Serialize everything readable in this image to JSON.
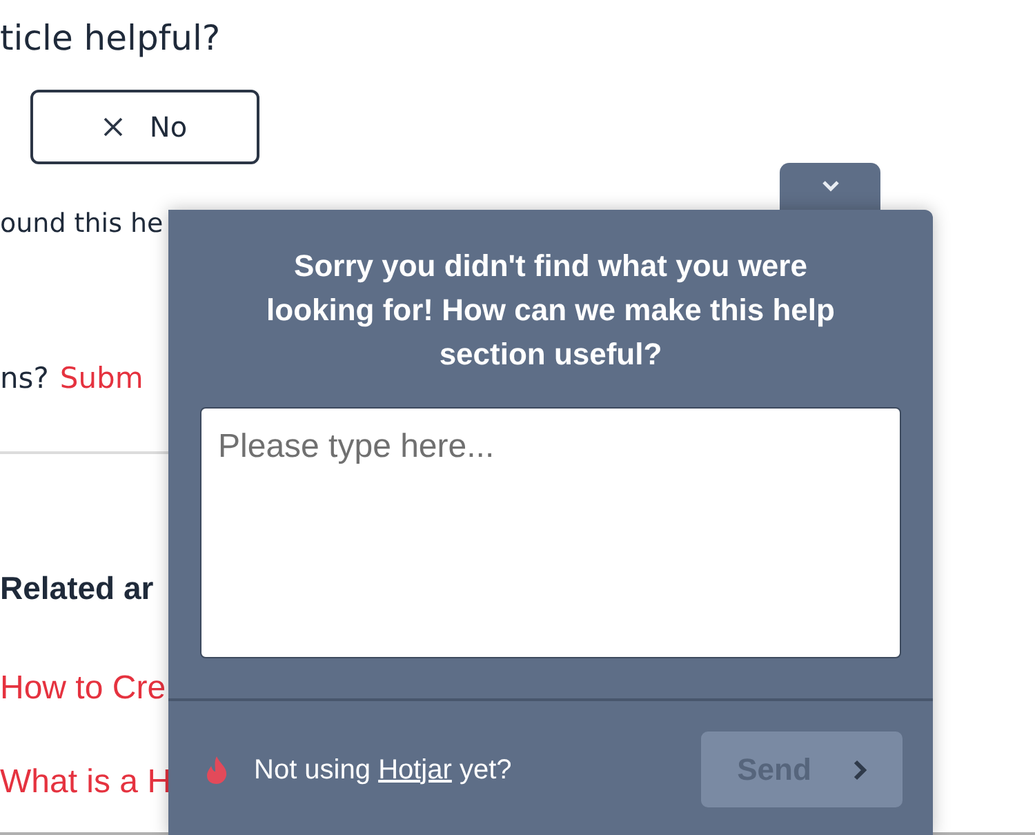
{
  "article": {
    "question": "ticle helpful?",
    "no_button": "No",
    "found_text": "ound this he",
    "contact_prefix": "ns?",
    "contact_link": "Subm",
    "related_heading": "Related ar",
    "related_links": [
      "How to Cre",
      "What is a H"
    ]
  },
  "feedback_widget": {
    "expanded": true,
    "heading": "Sorry you didn't find what you were looking for! How can we make this help section useful?",
    "placeholder": "Please type here...",
    "footer_prefix": "Not using",
    "footer_link": "Hotjar",
    "footer_suffix": "yet?",
    "send_button": {
      "label": "Send",
      "disabled": true
    }
  }
}
